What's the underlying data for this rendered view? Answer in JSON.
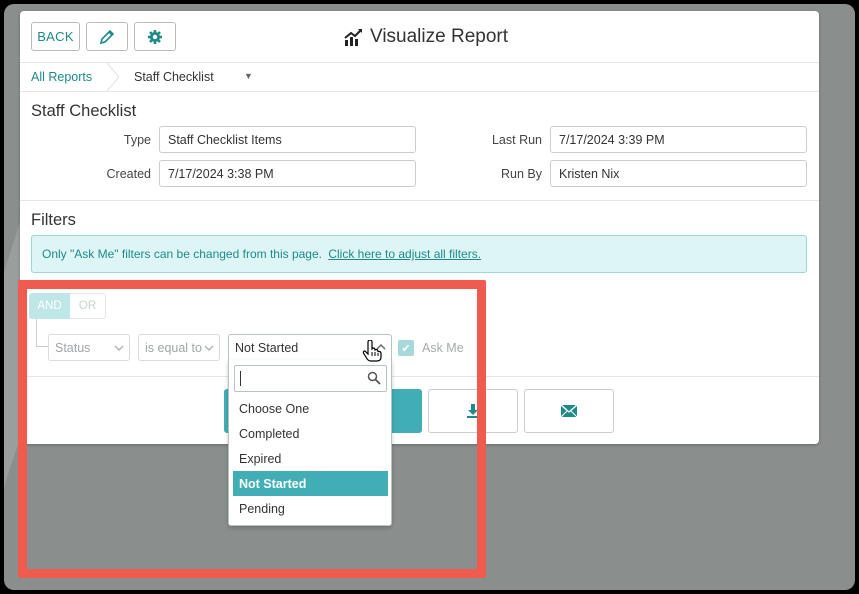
{
  "header": {
    "back_label": "BACK",
    "title": "Visualize Report",
    "edit_icon": "pencil-icon",
    "settings_icon": "gear-icon",
    "title_icon": "chart-trend-icon"
  },
  "breadcrumb": {
    "root": "All Reports",
    "current": "Staff Checklist"
  },
  "details": {
    "section_title": "Staff Checklist",
    "type_label": "Type",
    "type_value": "Staff Checklist Items",
    "created_label": "Created",
    "created_value": "7/17/2024 3:38 PM",
    "last_run_label": "Last Run",
    "last_run_value": "7/17/2024 3:39 PM",
    "run_by_label": "Run By",
    "run_by_value": "Kristen Nix"
  },
  "filters": {
    "section_title": "Filters",
    "info_text": "Only \"Ask Me\" filters can be changed from this page.",
    "info_link": "Click here to adjust all filters.",
    "and_label": "AND",
    "or_label": "OR",
    "field_value": "Status",
    "operator_value": "is equal to",
    "value_selected": "Not Started",
    "ask_me_label": "Ask Me",
    "ask_me_checked": true
  },
  "dropdown": {
    "search_value": "",
    "options": [
      "Choose One",
      "Completed",
      "Expired",
      "Not Started",
      "Pending"
    ],
    "selected": "Not Started"
  },
  "actions": {
    "download_icon": "download-icon",
    "email_icon": "envelope-icon"
  },
  "colors": {
    "accent": "#41aeb5",
    "link": "#1e8a8a",
    "highlight": "#f05b4f"
  }
}
